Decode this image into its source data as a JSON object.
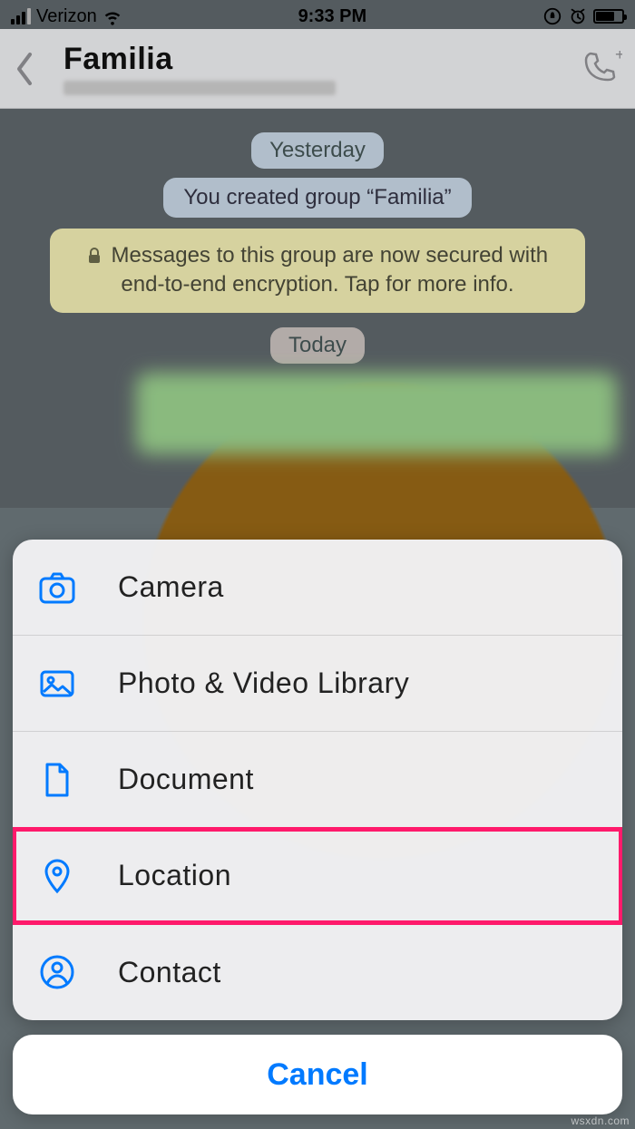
{
  "status": {
    "carrier": "Verizon",
    "time": "9:33 PM"
  },
  "nav": {
    "title": "Familia"
  },
  "chat": {
    "date_yesterday": "Yesterday",
    "system_created": "You created group “Familia”",
    "encryption_notice": "Messages to this group are now secured with end-to-end encryption. Tap for more info.",
    "date_today": "Today"
  },
  "sheet": {
    "camera": "Camera",
    "photo_video": "Photo & Video Library",
    "document": "Document",
    "location": "Location",
    "contact": "Contact",
    "cancel": "Cancel"
  },
  "colors": {
    "accent": "#007aff",
    "highlight": "#ff1a6b"
  },
  "watermark": "wsxdn.com"
}
